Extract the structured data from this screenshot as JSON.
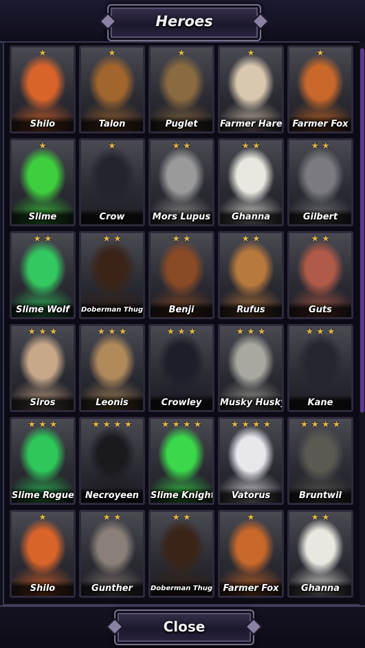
{
  "header": {
    "title": "Heroes"
  },
  "footer": {
    "close_label": "Close"
  },
  "star_glyph": "★",
  "heroes": [
    {
      "name": "Shilo",
      "stars": 1,
      "color": "#d9642a"
    },
    {
      "name": "Talon",
      "stars": 1,
      "color": "#a0662e"
    },
    {
      "name": "Puglet",
      "stars": 1,
      "color": "#8a6a40"
    },
    {
      "name": "Farmer Hare",
      "stars": 1,
      "color": "#d8c8b0"
    },
    {
      "name": "Farmer Fox",
      "stars": 1,
      "color": "#c8682a"
    },
    {
      "name": "Slime",
      "stars": 1,
      "color": "#3ecf3e"
    },
    {
      "name": "Crow",
      "stars": 1,
      "color": "#24242c"
    },
    {
      "name": "Mors Lupus",
      "stars": 2,
      "color": "#9a9a9a"
    },
    {
      "name": "Ghanna",
      "stars": 2,
      "color": "#e8e8e0"
    },
    {
      "name": "Gilbert",
      "stars": 2,
      "color": "#7a7a80"
    },
    {
      "name": "Slime Wolf",
      "stars": 2,
      "color": "#34c860"
    },
    {
      "name": "Doberman Thug",
      "stars": 2,
      "color": "#3a2418"
    },
    {
      "name": "Benji",
      "stars": 2,
      "color": "#8a4a26"
    },
    {
      "name": "Rufus",
      "stars": 2,
      "color": "#b87a3c"
    },
    {
      "name": "Guts",
      "stars": 2,
      "color": "#b05a48"
    },
    {
      "name": "Siros",
      "stars": 3,
      "color": "#c8a88a"
    },
    {
      "name": "Leonis",
      "stars": 3,
      "color": "#b08a5a"
    },
    {
      "name": "Crowley",
      "stars": 3,
      "color": "#1e1e2a"
    },
    {
      "name": "Musky Husky",
      "stars": 3,
      "color": "#a8a8a0"
    },
    {
      "name": "Kane",
      "stars": 3,
      "color": "#26262e"
    },
    {
      "name": "Slime Rogue",
      "stars": 3,
      "color": "#2ec85a"
    },
    {
      "name": "Necroyeen",
      "stars": 4,
      "color": "#1a1a1e"
    },
    {
      "name": "Slime Knight",
      "stars": 4,
      "color": "#3ad84a"
    },
    {
      "name": "Vatorus",
      "stars": 4,
      "color": "#e8e8ec"
    },
    {
      "name": "Bruntwil",
      "stars": 4,
      "color": "#5a5a52"
    },
    {
      "name": "Shilo",
      "stars": 1,
      "color": "#d9642a"
    },
    {
      "name": "Gunther",
      "stars": 2,
      "color": "#8a8078"
    },
    {
      "name": "Doberman Thug",
      "stars": 2,
      "color": "#3a2418"
    },
    {
      "name": "Farmer Fox",
      "stars": 1,
      "color": "#c8682a"
    },
    {
      "name": "Ghanna",
      "stars": 2,
      "color": "#e8e8e0"
    }
  ]
}
